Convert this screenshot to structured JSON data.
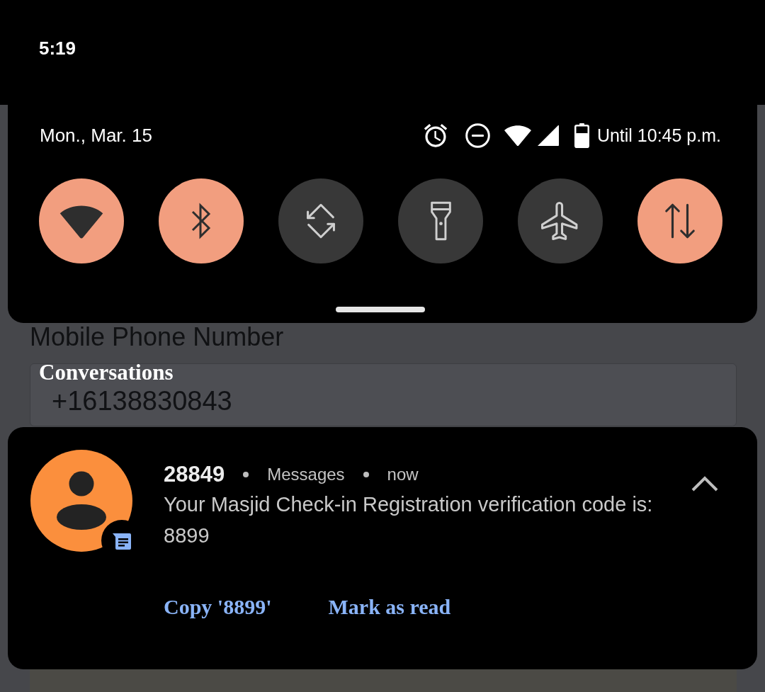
{
  "status_bar": {
    "time": "5:19"
  },
  "quick_settings": {
    "date": "Mon., Mar. 15",
    "battery_status": "Until 10:45 p.m.",
    "tiles": [
      {
        "kind": "wifi",
        "on": true
      },
      {
        "kind": "bluetooth",
        "on": true
      },
      {
        "kind": "auto_rotate",
        "on": false
      },
      {
        "kind": "flashlight",
        "on": false
      },
      {
        "kind": "airplane_mode",
        "on": false
      },
      {
        "kind": "mobile_data",
        "on": true
      }
    ]
  },
  "background_app": {
    "field_label": "Mobile Phone Number",
    "field_value": "+16138830843"
  },
  "notifications": {
    "section_title": "Conversations",
    "items": [
      {
        "sender": "28849",
        "app": "Messages",
        "time": "now",
        "body": "Your Masjid Check-in Registration verification code is: 8899",
        "expanded": true,
        "actions": [
          "Copy '8899'",
          "Mark as read"
        ]
      }
    ]
  }
}
